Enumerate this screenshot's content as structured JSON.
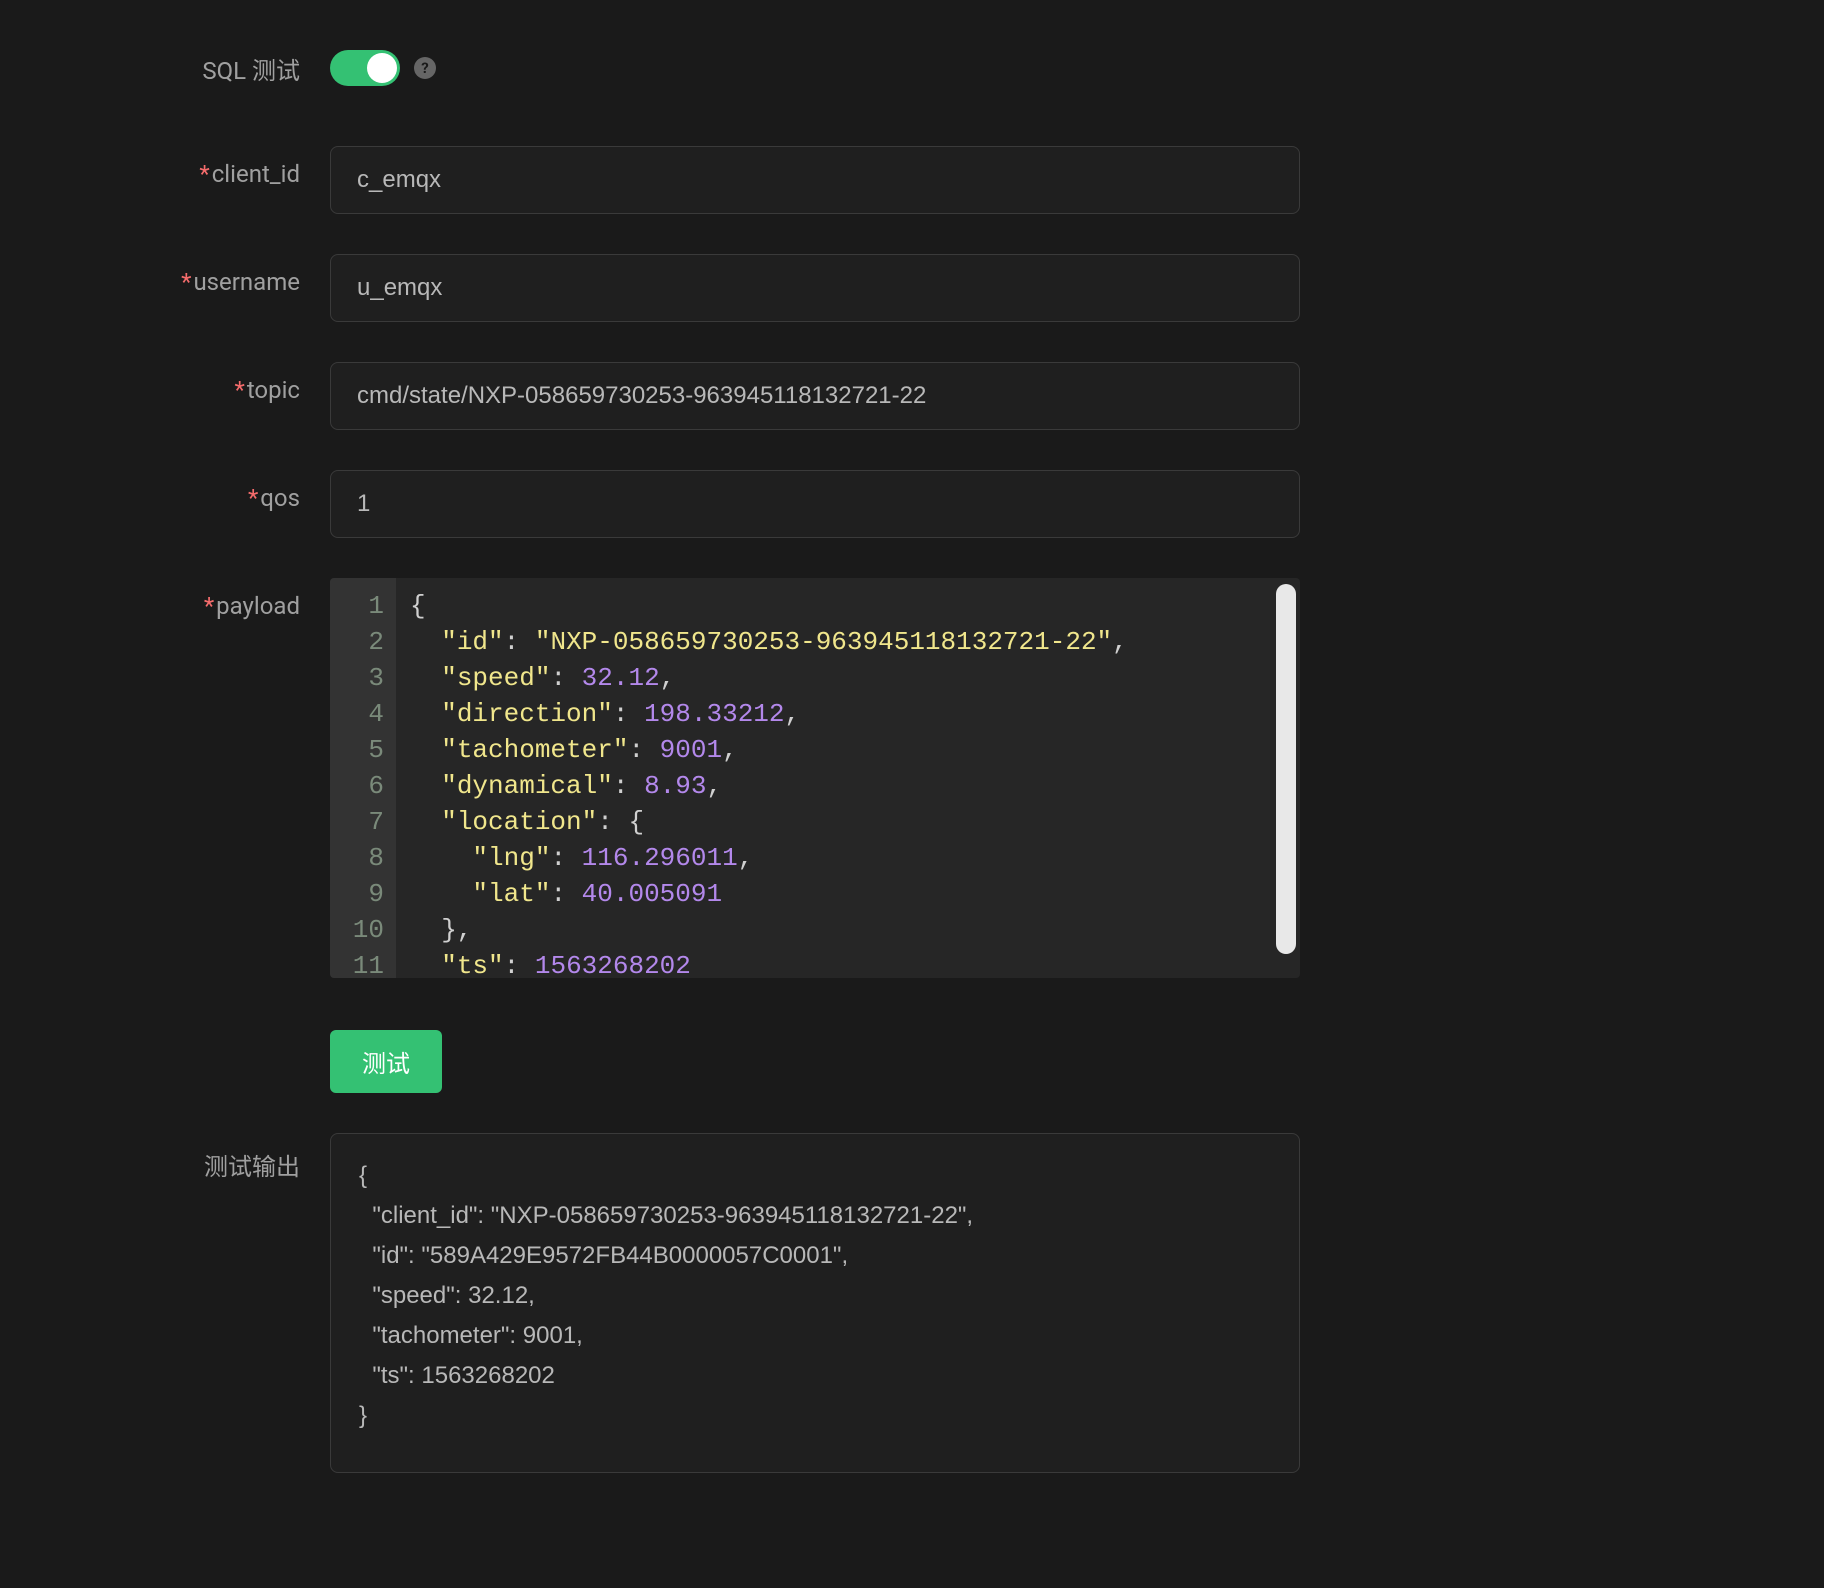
{
  "toggle": {
    "label": "SQL 测试",
    "on": true
  },
  "fields": {
    "client_id": {
      "label": "client_id",
      "value": "c_emqx"
    },
    "username": {
      "label": "username",
      "value": "u_emqx"
    },
    "topic": {
      "label": "topic",
      "value": "cmd/state/NXP-058659730253-963945118132721-22"
    },
    "qos": {
      "label": "qos",
      "value": "1"
    },
    "payload": {
      "label": "payload"
    }
  },
  "payload_lines": [
    [
      {
        "t": "p",
        "v": "{"
      }
    ],
    [
      {
        "t": "p",
        "v": "  "
      },
      {
        "t": "k",
        "v": "\"id\""
      },
      {
        "t": "c",
        "v": ": "
      },
      {
        "t": "s",
        "v": "\"NXP-058659730253-963945118132721-22\""
      },
      {
        "t": "c",
        "v": ","
      }
    ],
    [
      {
        "t": "p",
        "v": "  "
      },
      {
        "t": "k",
        "v": "\"speed\""
      },
      {
        "t": "c",
        "v": ": "
      },
      {
        "t": "n",
        "v": "32.12"
      },
      {
        "t": "c",
        "v": ","
      }
    ],
    [
      {
        "t": "p",
        "v": "  "
      },
      {
        "t": "k",
        "v": "\"direction\""
      },
      {
        "t": "c",
        "v": ": "
      },
      {
        "t": "n",
        "v": "198.33212"
      },
      {
        "t": "c",
        "v": ","
      }
    ],
    [
      {
        "t": "p",
        "v": "  "
      },
      {
        "t": "k",
        "v": "\"tachometer\""
      },
      {
        "t": "c",
        "v": ": "
      },
      {
        "t": "n",
        "v": "9001"
      },
      {
        "t": "c",
        "v": ","
      }
    ],
    [
      {
        "t": "p",
        "v": "  "
      },
      {
        "t": "k",
        "v": "\"dynamical\""
      },
      {
        "t": "c",
        "v": ": "
      },
      {
        "t": "n",
        "v": "8.93"
      },
      {
        "t": "c",
        "v": ","
      }
    ],
    [
      {
        "t": "p",
        "v": "  "
      },
      {
        "t": "k",
        "v": "\"location\""
      },
      {
        "t": "c",
        "v": ": {"
      }
    ],
    [
      {
        "t": "p",
        "v": "    "
      },
      {
        "t": "k",
        "v": "\"lng\""
      },
      {
        "t": "c",
        "v": ": "
      },
      {
        "t": "n",
        "v": "116.296011"
      },
      {
        "t": "c",
        "v": ","
      }
    ],
    [
      {
        "t": "p",
        "v": "    "
      },
      {
        "t": "k",
        "v": "\"lat\""
      },
      {
        "t": "c",
        "v": ": "
      },
      {
        "t": "n",
        "v": "40.005091"
      }
    ],
    [
      {
        "t": "p",
        "v": "  },"
      }
    ],
    [
      {
        "t": "p",
        "v": "  "
      },
      {
        "t": "k",
        "v": "\"ts\""
      },
      {
        "t": "c",
        "v": ": "
      },
      {
        "t": "n",
        "v": "1563268202"
      }
    ]
  ],
  "buttons": {
    "test": "测试"
  },
  "output": {
    "label": "测试输出",
    "text": "{\n  \"client_id\": \"NXP-058659730253-963945118132721-22\",\n  \"id\": \"589A429E9572FB44B0000057C0001\",\n  \"speed\": 32.12,\n  \"tachometer\": 9001,\n  \"ts\": 1563268202\n}"
  }
}
